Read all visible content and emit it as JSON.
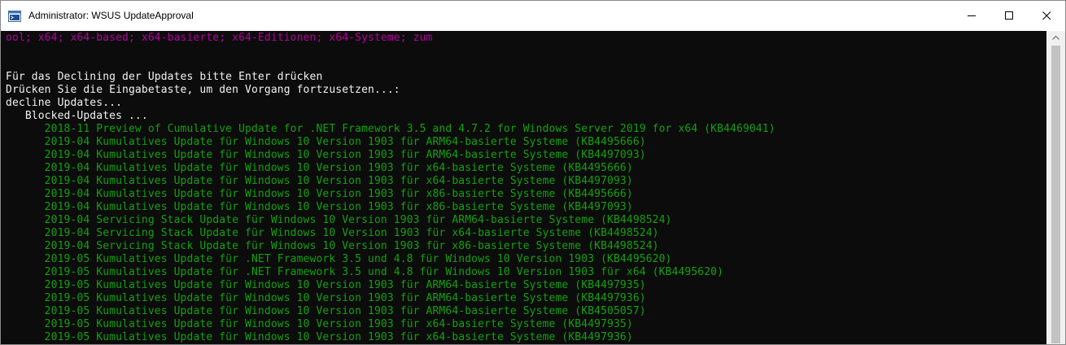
{
  "window": {
    "title": "Administrator: WSUS UpdateApproval",
    "icon": "powershell-console-icon",
    "controls": [
      "minimize-icon",
      "maximize-icon",
      "close-icon"
    ]
  },
  "console": {
    "lines": [
      {
        "text": "ool; x64; x64-based; x64-basierte; x64-Editionen; x64-Systeme; zum",
        "color": "#b4009e"
      },
      {
        "text": "",
        "color": "#f2f2f2"
      },
      {
        "text": "",
        "color": "#f2f2f2"
      },
      {
        "text": "Für das Declining der Updates bitte Enter drücken",
        "color": "#f2f2f2"
      },
      {
        "text": "Drücken Sie die Eingabetaste, um den Vorgang fortzusetzen...:",
        "color": "#f2f2f2"
      },
      {
        "text": "decline Updates...",
        "color": "#f2f2f2"
      },
      {
        "text": "   Blocked-Updates ...",
        "color": "#f2f2f2"
      },
      {
        "text": "      2018-11 Preview of Cumulative Update for .NET Framework 3.5 and 4.7.2 for Windows Server 2019 for x64 (KB4469041)",
        "color": "#13a10e"
      },
      {
        "text": "      2019-04 Kumulatives Update für Windows 10 Version 1903 für ARM64-basierte Systeme (KB4495666)",
        "color": "#13a10e"
      },
      {
        "text": "      2019-04 Kumulatives Update für Windows 10 Version 1903 für ARM64-basierte Systeme (KB4497093)",
        "color": "#13a10e"
      },
      {
        "text": "      2019-04 Kumulatives Update für Windows 10 Version 1903 für x64-basierte Systeme (KB4495666)",
        "color": "#13a10e"
      },
      {
        "text": "      2019-04 Kumulatives Update für Windows 10 Version 1903 für x64-basierte Systeme (KB4497093)",
        "color": "#13a10e"
      },
      {
        "text": "      2019-04 Kumulatives Update für Windows 10 Version 1903 für x86-basierte Systeme (KB4495666)",
        "color": "#13a10e"
      },
      {
        "text": "      2019-04 Kumulatives Update für Windows 10 Version 1903 für x86-basierte Systeme (KB4497093)",
        "color": "#13a10e"
      },
      {
        "text": "      2019-04 Servicing Stack Update für Windows 10 Version 1903 für ARM64-basierte Systeme (KB4498524)",
        "color": "#13a10e"
      },
      {
        "text": "      2019-04 Servicing Stack Update für Windows 10 Version 1903 für x64-basierte Systeme (KB4498524)",
        "color": "#13a10e"
      },
      {
        "text": "      2019-04 Servicing Stack Update für Windows 10 Version 1903 für x86-basierte Systeme (KB4498524)",
        "color": "#13a10e"
      },
      {
        "text": "      2019-05 Kumulatives Update für .NET Framework 3.5 und 4.8 für Windows 10 Version 1903 (KB4495620)",
        "color": "#13a10e"
      },
      {
        "text": "      2019-05 Kumulatives Update für .NET Framework 3.5 und 4.8 für Windows 10 Version 1903 für x64 (KB4495620)",
        "color": "#13a10e"
      },
      {
        "text": "      2019-05 Kumulatives Update für Windows 10 Version 1903 für ARM64-basierte Systeme (KB4497935)",
        "color": "#13a10e"
      },
      {
        "text": "      2019-05 Kumulatives Update für Windows 10 Version 1903 für ARM64-basierte Systeme (KB4497936)",
        "color": "#13a10e"
      },
      {
        "text": "      2019-05 Kumulatives Update für Windows 10 Version 1903 für ARM64-basierte Systeme (KB4505057)",
        "color": "#13a10e"
      },
      {
        "text": "      2019-05 Kumulatives Update für Windows 10 Version 1903 für x64-basierte Systeme (KB4497935)",
        "color": "#13a10e"
      },
      {
        "text": "      2019-05 Kumulatives Update für Windows 10 Version 1903 für x64-basierte Systeme (KB4497936)",
        "color": "#13a10e"
      }
    ]
  },
  "scrollbar": {
    "up_arrow_icon": "chevron-up-icon"
  }
}
